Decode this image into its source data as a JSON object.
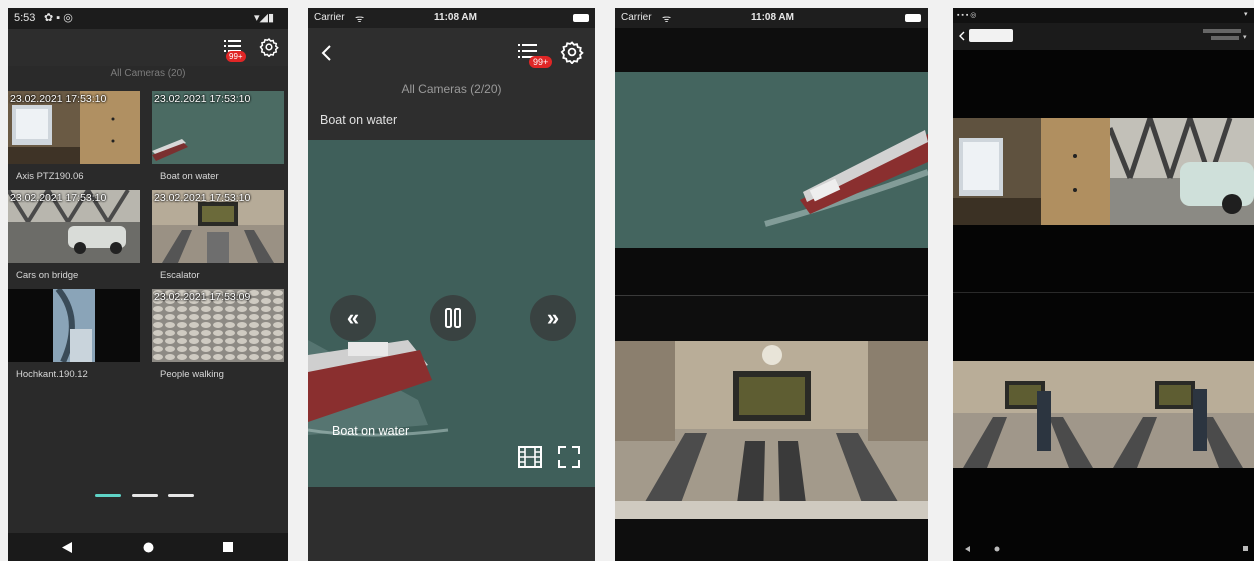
{
  "colors": {
    "accent": "#5fd3c6",
    "badge": "#e02626",
    "screen_bg": "#2a2a2a"
  },
  "screen1": {
    "status_time": "5:53",
    "camera_header": "All Cameras (20)",
    "badge": "99+",
    "tiles": [
      {
        "timestamp": "23.02.2021 17:53:10",
        "caption": "Axis PTZ190.06"
      },
      {
        "timestamp": "23.02.2021 17:53:10",
        "caption": "Boat on water"
      },
      {
        "timestamp": "23.02.2021 17:53:10",
        "caption": "Cars on bridge"
      },
      {
        "timestamp": "23.02.2021 17:53:10",
        "caption": "Escalator"
      },
      {
        "timestamp": "",
        "caption": "Hochkant.190.12"
      },
      {
        "timestamp": "23.02.2021 17:53:09",
        "caption": "People walking"
      }
    ],
    "icons": [
      "list-icon",
      "gear-icon",
      "back-triangle-icon",
      "home-circle-icon",
      "recents-square-icon"
    ]
  },
  "screen2": {
    "carrier": "Carrier",
    "time": "11:08 AM",
    "badge": "99+",
    "camera_header": "All Cameras (2/20)",
    "camera_name": "Boat on water",
    "overlay_label": "Boat on water",
    "icons": [
      "back-chevron-icon",
      "list-icon",
      "gear-icon",
      "rewind-icon",
      "pause-icon",
      "forward-icon",
      "film-icon",
      "fullscreen-icon"
    ]
  },
  "screen3": {
    "carrier": "Carrier",
    "time": "11:08 AM"
  }
}
